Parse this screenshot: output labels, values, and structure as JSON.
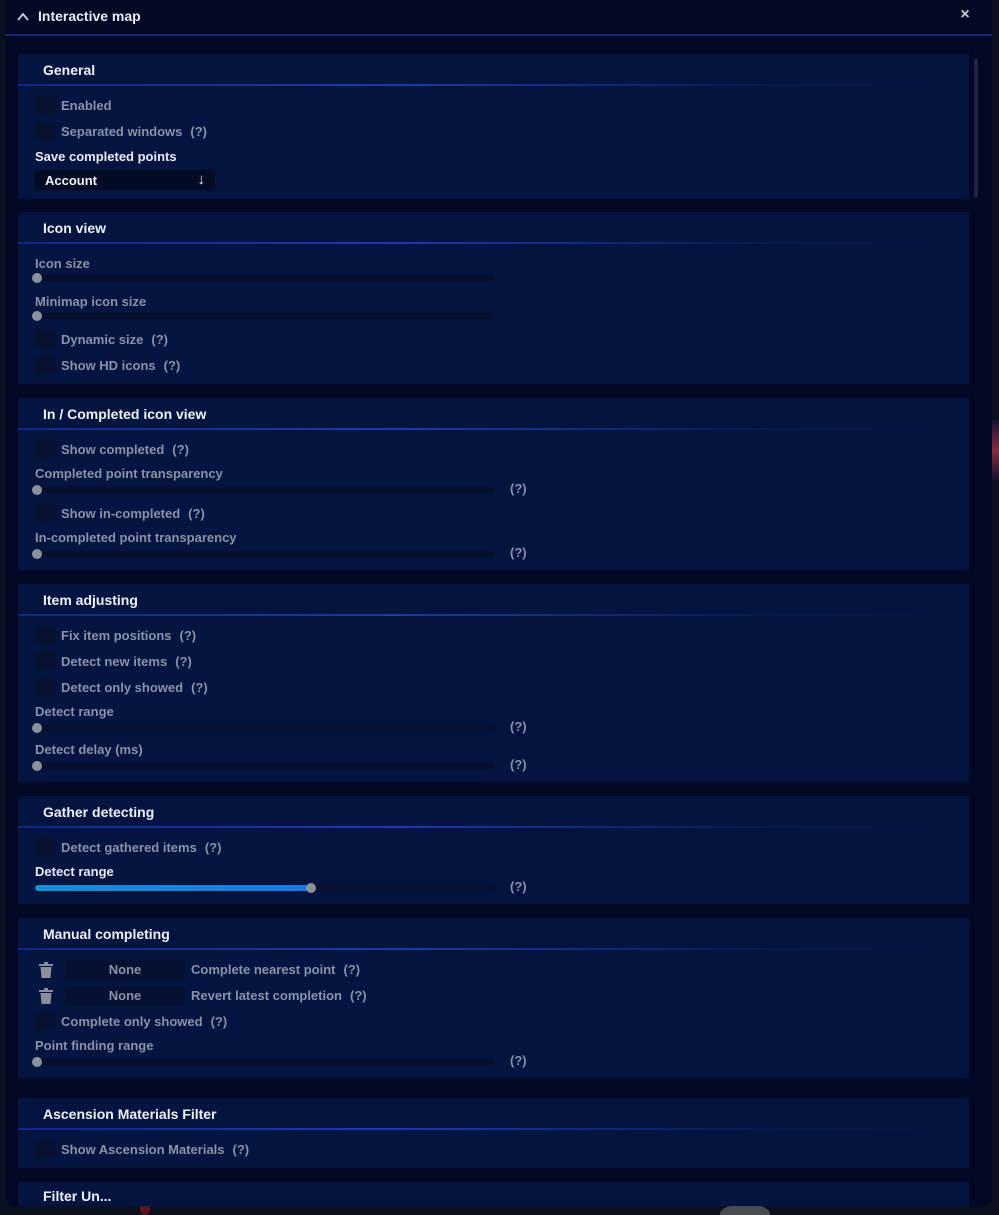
{
  "window": {
    "title": "Interactive map",
    "close_glyph": "×"
  },
  "sections": {
    "general": {
      "title": "General",
      "enabled": "Enabled",
      "separated": "Separated windows",
      "save_label": "Save completed points",
      "save_value": "Account",
      "save_arrow": "↓"
    },
    "icon_view": {
      "title": "Icon view",
      "icon_size": "Icon size",
      "minimap_icon_size": "Minimap icon size",
      "dynamic_size": "Dynamic size",
      "show_hd": "Show HD icons"
    },
    "in_completed": {
      "title": "In / Completed icon view",
      "show_completed": "Show completed",
      "completed_transparency": "Completed point transparency",
      "show_in_completed": "Show in-completed",
      "in_completed_transparency": "In-completed point transparency"
    },
    "item_adjusting": {
      "title": "Item adjusting",
      "fix_positions": "Fix item positions",
      "detect_new": "Detect new items",
      "detect_only_showed": "Detect only showed",
      "detect_range": "Detect range",
      "detect_delay": "Detect delay (ms)"
    },
    "gather": {
      "title": "Gather detecting",
      "detect_gathered": "Detect gathered items",
      "detect_range": "Detect range",
      "detect_range_level": 0.6
    },
    "manual": {
      "title": "Manual completing",
      "key1": "None",
      "complete_nearest": "Complete nearest point",
      "key2": "None",
      "revert_latest": "Revert latest completion",
      "complete_only_showed": "Complete only showed",
      "point_finding_range": "Point finding range"
    },
    "ascension": {
      "title": "Ascension Materials Filter",
      "show_ascension": "Show Ascension Materials"
    },
    "next": {
      "title": "Filter Un..."
    }
  },
  "help": "(?)",
  "colors": {
    "accent": "#1a78e0",
    "panel": "#041440",
    "background": "#020824"
  }
}
